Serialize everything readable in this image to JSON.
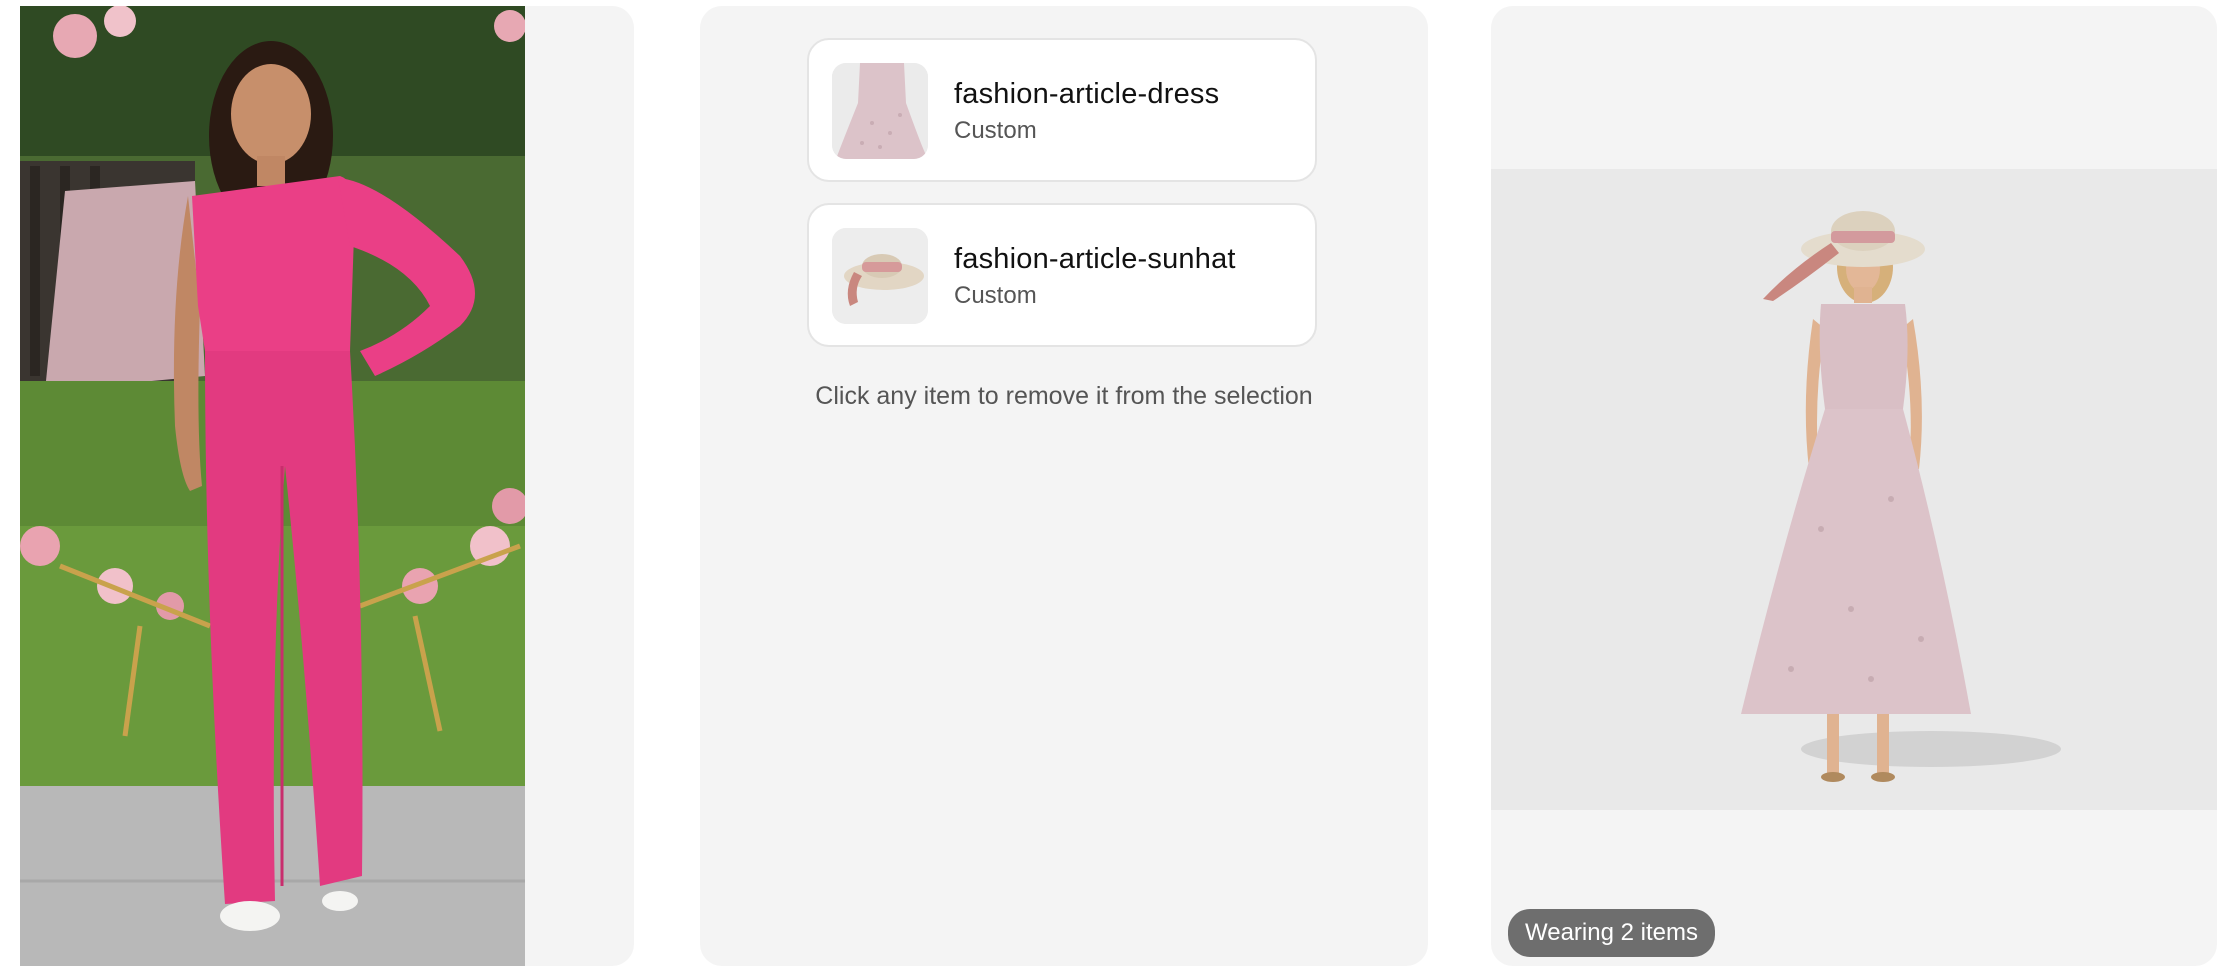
{
  "selection": {
    "items": [
      {
        "name": "fashion-article-dress",
        "source": "Custom"
      },
      {
        "name": "fashion-article-sunhat",
        "source": "Custom"
      }
    ],
    "hint": "Click any item to remove it from the selection"
  },
  "result": {
    "badge": "Wearing 2 items"
  },
  "colors": {
    "panel_bg": "#f4f4f4",
    "card_border": "#e4e4e4",
    "badge_bg": "#6e6e6e",
    "jumpsuit": "#ea3f86",
    "dress": "#dcc3c9"
  }
}
